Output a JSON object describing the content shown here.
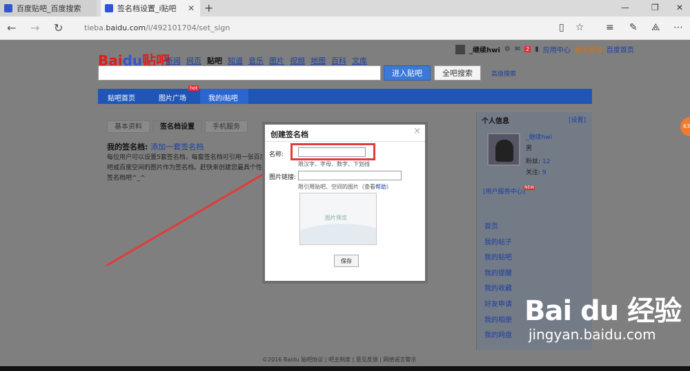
{
  "browser": {
    "tabs": [
      {
        "label": "百度贴吧_百度搜索"
      },
      {
        "label": "签名档设置_i贴吧"
      }
    ],
    "url_prefix": "tieba.",
    "url_domain": "baidu.com",
    "url_path": "/i/492101704/set_sign"
  },
  "header": {
    "logo_text": "Bai",
    "logo_paw": "du",
    "logo_suffix": "贴吧",
    "nav": [
      "新闻",
      "网页",
      "贴吧",
      "知道",
      "音乐",
      "图片",
      "视频",
      "地图",
      "百科",
      "文库"
    ],
    "user": "_继续hwi",
    "badge_count": "2",
    "links": [
      "应用中心",
      "会员官网",
      "百度首页"
    ],
    "enter_button": "进入贴吧",
    "search_all_button": "全吧搜索",
    "advanced_search": "高级搜索"
  },
  "mainnav": {
    "items": [
      "贴吧首页",
      "图片广场",
      "我的i贴吧"
    ],
    "hot_tag": "hot"
  },
  "content": {
    "tabs": [
      "基本资料",
      "签名档设置",
      "手机服务"
    ],
    "my_sig_label": "我的签名档:",
    "add_sig_link": "添加一套签名档",
    "desc": "每位用户可以设置5套签名档，每套签名档可引用一张百度贴吧或百度空间的图片作为签名档。赶快来创建您最具个性的签名档吧^_^"
  },
  "sidebar": {
    "title": "个人信息",
    "settings": "[设置]",
    "username": "_继续hwi",
    "gender": "男",
    "fans_label": "粉丝:",
    "fans": "12",
    "follow_label": "关注:",
    "follow": "9",
    "service_center": "[用户服务中心]",
    "new_tag": "NEW",
    "links": [
      "首页",
      "我的帖子",
      "我的贴吧",
      "我的提醒",
      "我的收藏",
      "好友申请",
      "我的相册",
      "我的网盘"
    ]
  },
  "footer": {
    "text": "©2016 Baidu 贴吧协议 | 吧主制度 | 意见反馈 | 网络谣言警示"
  },
  "modal": {
    "title": "创建签名档",
    "close": "×",
    "name_label": "名称:",
    "name_hint": "限汉字、字母、数字、下划线",
    "img_label": "图片链接:",
    "img_hint_prefix": "限引用贴吧、空间的图片（查看",
    "img_hint_link": "帮助",
    "img_hint_suffix": "）",
    "preview_text": "图片预览",
    "save_button": "保存"
  },
  "overlay": {
    "bubble": "63",
    "watermark_logo": "Bai du 经验",
    "watermark_url": "jingyan.baidu.com"
  },
  "colors": {
    "annotation_red": "#e23b3b",
    "nav_blue": "#1f56b5",
    "link_blue": "#1a3fa0"
  }
}
